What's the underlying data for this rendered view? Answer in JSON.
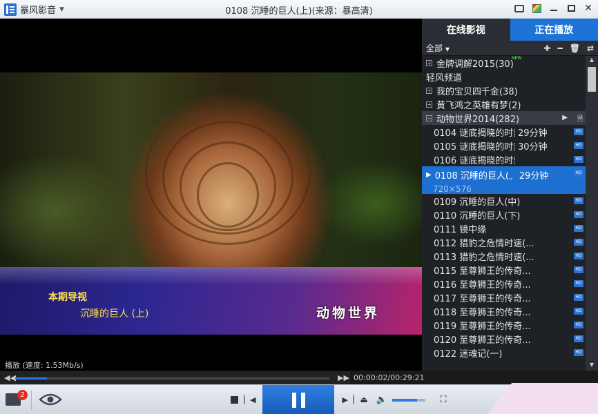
{
  "app": {
    "name": "暴风影音",
    "window_title": "0108 沉睡的巨人(上)(来源：暴高清)"
  },
  "video": {
    "banner_title": "本期导视",
    "banner_subtitle": "沉睡的巨人  (上)",
    "banner_brand": "动物世界",
    "status": "播放 (速度: 1.53Mb/s)",
    "progress_percent": 0.1,
    "time": "00:00:02/00:29:21"
  },
  "sidebar": {
    "tabs": [
      {
        "label": "在线影视",
        "active": false
      },
      {
        "label": "正在播放",
        "active": true
      }
    ],
    "filter_label": "全部",
    "groups_top": [
      {
        "label": "金牌调解2015(30)",
        "expander": "+",
        "badge": "NEW"
      },
      {
        "label": "轻风频道"
      },
      {
        "label": "我的宝贝四千金(38)",
        "expander": "+"
      },
      {
        "label": "黄飞鸿之英雄有梦(2)",
        "expander": "+"
      },
      {
        "label": "动物世界2014(282)",
        "expander": "−"
      }
    ],
    "items_before": [
      {
        "title": "0104 谜底揭晓的时刻(...",
        "duration": "29分钟"
      },
      {
        "title": "0105 谜底揭晓的时刻(...",
        "duration": "30分钟"
      },
      {
        "title": "0106 谜底揭晓的时刻(...",
        "duration": ""
      }
    ],
    "selected_item": {
      "title": "0108  沉睡的巨人(上)",
      "duration": "29分钟",
      "resolution": "720×576"
    },
    "items_after": [
      {
        "title": "0109 沉睡的巨人(中)"
      },
      {
        "title": "0110 沉睡的巨人(下)"
      },
      {
        "title": "0111 镜中缘"
      },
      {
        "title": "0112 猎豹之危情时速(..."
      },
      {
        "title": "0113 猎豹之危情时速(..."
      },
      {
        "title": "0115 至尊狮王的传奇..."
      },
      {
        "title": "0116 至尊狮王的传奇..."
      },
      {
        "title": "0117 至尊狮王的传奇..."
      },
      {
        "title": "0118 至尊狮王的传奇..."
      },
      {
        "title": "0119 至尊狮王的传奇..."
      },
      {
        "title": "0120 至尊狮王的传奇..."
      },
      {
        "title": "0122 迷魂记(一)"
      }
    ],
    "hd_label": "HD"
  },
  "controls": {
    "toolbox_badge": "2",
    "volume_percent": 0.75
  },
  "colors": {
    "accent": "#1d73d6",
    "dark_bg": "#1e2126"
  }
}
